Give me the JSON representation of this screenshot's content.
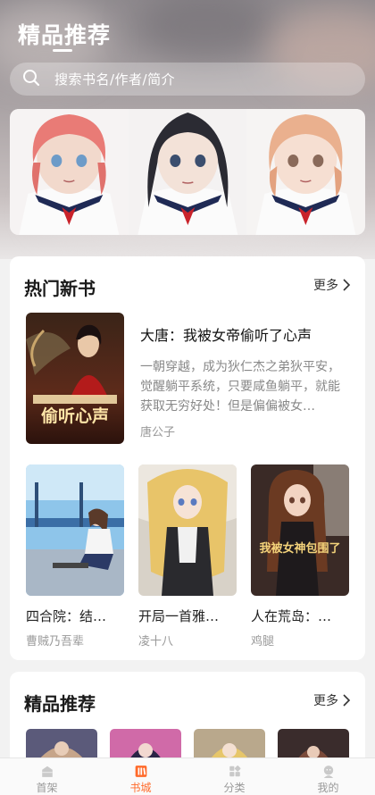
{
  "header": {
    "title": "精品推荐",
    "search_placeholder": "搜索书名/作者/简介"
  },
  "hot_section": {
    "title": "热门新书",
    "more_label": "更多",
    "featured": {
      "title": "大唐：我被女帝偷听了心声",
      "description": "一朝穿越，成为狄仁杰之弟狄平安，觉醒躺平系统，只要咸鱼躺平，就能获取无穷好处！但是偏偏被女…",
      "author": "唐公子",
      "cover_text": "偷听心声"
    },
    "books": [
      {
        "title": "四合院：结…",
        "author": "曹贼乃吾辈"
      },
      {
        "title": "开局一首雅…",
        "author": "凌十八"
      },
      {
        "title": "人在荒岛：…",
        "author": "鸡腿",
        "cover_text": "我被女神包围了"
      }
    ]
  },
  "rec_section": {
    "title": "精品推荐",
    "more_label": "更多"
  },
  "tabbar": {
    "tabs": [
      {
        "label": "首架",
        "icon": "bookshelf-icon"
      },
      {
        "label": "书城",
        "icon": "bookstore-icon",
        "active": true
      },
      {
        "label": "分类",
        "icon": "category-icon"
      },
      {
        "label": "我的",
        "icon": "profile-icon"
      }
    ]
  },
  "colors": {
    "accent": "#ff6a2a",
    "text_muted": "#999999",
    "header_bg": "#a9a2a4"
  }
}
